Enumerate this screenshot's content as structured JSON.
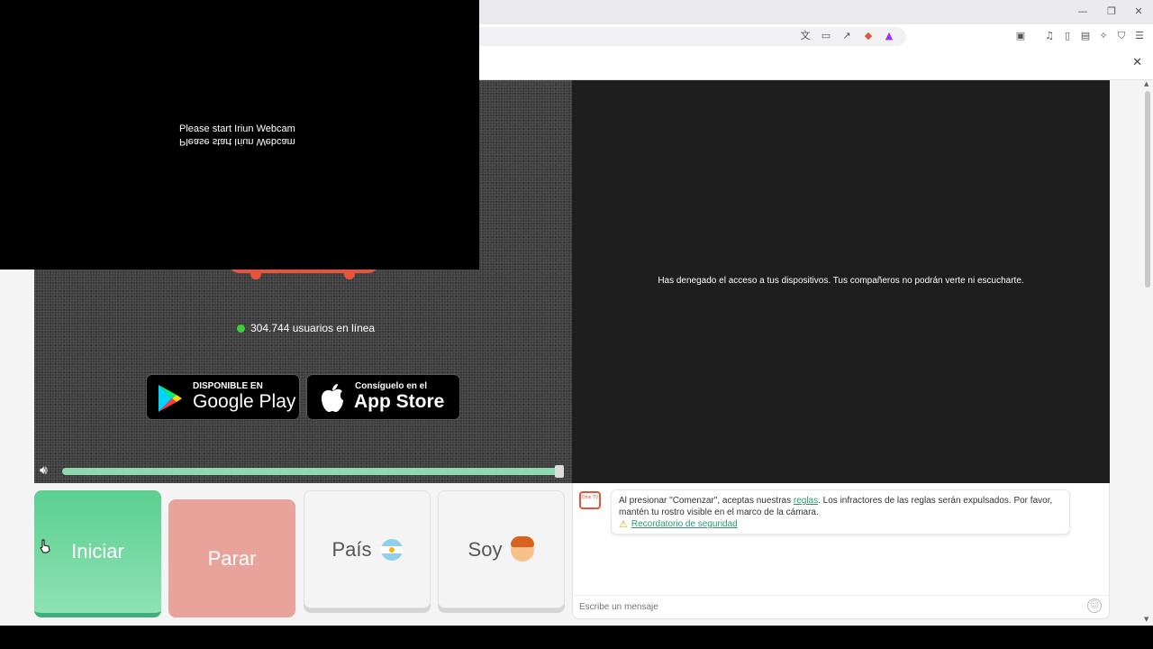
{
  "browser": {
    "icons": [
      "translate-icon",
      "screencast-icon",
      "share-icon",
      "brave-shield-icon",
      "rewards-icon",
      "reader-icon",
      "media-icon",
      "sidebar-icon",
      "wallet-icon",
      "leo-icon",
      "vpn-icon",
      "menu-icon"
    ],
    "window_controls": [
      "minimize",
      "restore",
      "close"
    ]
  },
  "webcam_overlay": {
    "line1": "Please start Iriun Webcam",
    "line2": "Please start Iriun Webcam"
  },
  "left_video": {
    "online_count": "304.744 usuarios en línea",
    "google_play": {
      "small": "DISPONIBLE EN",
      "big": "Google Play"
    },
    "app_store": {
      "small": "Consíguelo en el",
      "big": "App Store"
    },
    "volume_level": 1.0
  },
  "right_video": {
    "denied_message": "Has denegado el acceso a tus dispositivos. Tus compañeros no podrán verte ni escucharte."
  },
  "controls": {
    "start_label": "Iniciar",
    "stop_label": "Parar",
    "country_label": "País",
    "soy_label": "Soy"
  },
  "chat": {
    "logo_text": "Ome TV",
    "notice_before_link": "Al presionar \"Comenzar\", aceptas nuestras ",
    "notice_link": "reglas",
    "notice_after_link": ". Los infractores de las reglas serán expulsados. Por favor, mantén tu rostro visible en el marco de la cámara.",
    "safety_link": "Recordatorio de seguridad",
    "input_placeholder": "Escribe un mensaje"
  },
  "colors": {
    "start": "#5ccf8f",
    "stop": "#e8a49b",
    "link": "#2a9a6a",
    "online_dot": "#3ecf3e"
  }
}
